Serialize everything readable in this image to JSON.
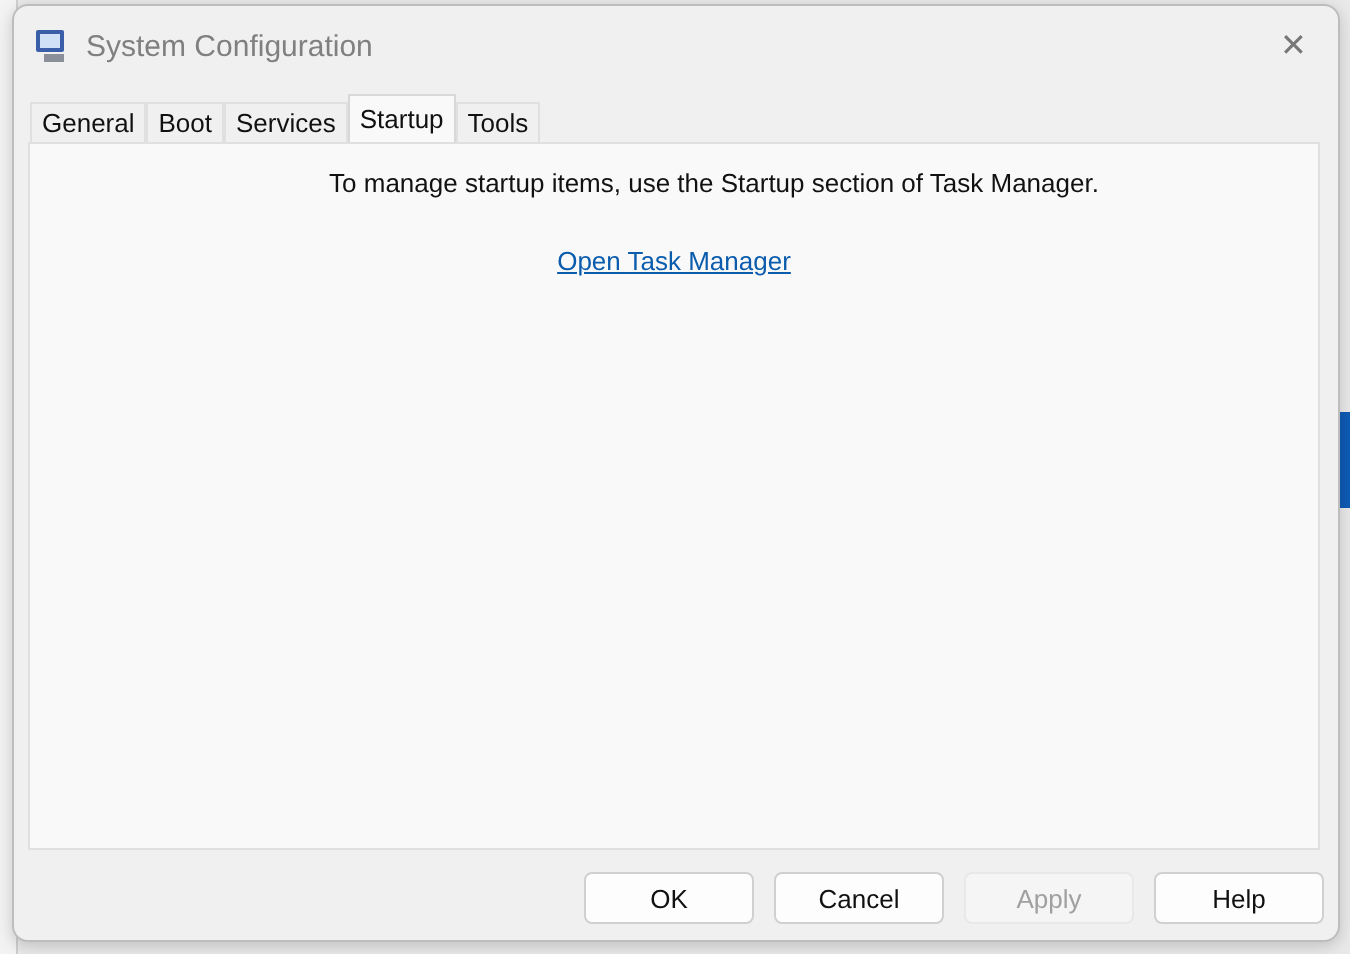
{
  "window": {
    "title": "System Configuration",
    "close": "✕"
  },
  "tabs": [
    {
      "label": "General",
      "selected": false
    },
    {
      "label": "Boot",
      "selected": false
    },
    {
      "label": "Services",
      "selected": false
    },
    {
      "label": "Startup",
      "selected": true
    },
    {
      "label": "Tools",
      "selected": false
    }
  ],
  "content": {
    "message": "To manage startup items, use the Startup section of Task Manager.",
    "link": "Open Task Manager"
  },
  "buttons": [
    {
      "label": "OK",
      "disabled": false
    },
    {
      "label": "Cancel",
      "disabled": false
    },
    {
      "label": "Apply",
      "disabled": true
    },
    {
      "label": "Help",
      "disabled": false
    }
  ]
}
